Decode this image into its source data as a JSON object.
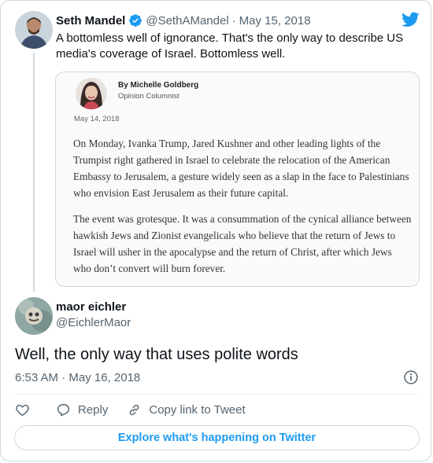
{
  "parent_tweet": {
    "name": "Seth Mandel",
    "handle": "@SethAMandel",
    "separator": "·",
    "date": "May 15, 2018",
    "text": "A bottomless well of ignorance. That's the only way to describe US media's coverage of Israel. Bottomless well.",
    "verified_icon": "verified-badge-icon",
    "brand_icon": "twitter-bird-icon",
    "embedded_article": {
      "byline": "By Michelle Goldberg",
      "role": "Opinion Columnist",
      "date": "May 14, 2018",
      "paragraphs": [
        "On Monday, Ivanka Trump, Jared Kushner and other leading lights of the Trumpist right gathered in Israel to celebrate the relocation of the American Embassy to Jerusalem, a gesture widely seen as a slap in the face to Palestinians who envision East Jerusalem as their future capital.",
        "The event was grotesque. It was a consummation of the cynical alliance between hawkish Jews and Zionist evangelicals who believe that the return of Jews to Israel will usher in the apocalypse and the return of Christ, after which Jews who don’t convert will burn forever."
      ]
    }
  },
  "reply_tweet": {
    "name": "maor eichler",
    "handle": "@EichlerMaor",
    "text": "Well, the only way that uses polite words",
    "timestamp": "6:53 AM · May 16, 2018",
    "info_icon": "info-icon"
  },
  "actions": {
    "like_icon": "heart-icon",
    "reply_label": "Reply",
    "reply_icon": "reply-icon",
    "copy_label": "Copy link to Tweet",
    "copy_icon": "link-icon"
  },
  "explore_button": "Explore what's happening on Twitter",
  "colors": {
    "accent": "#1d9bf0",
    "text_primary": "#0f1419",
    "text_secondary": "#536471",
    "border": "#cfd9de"
  }
}
